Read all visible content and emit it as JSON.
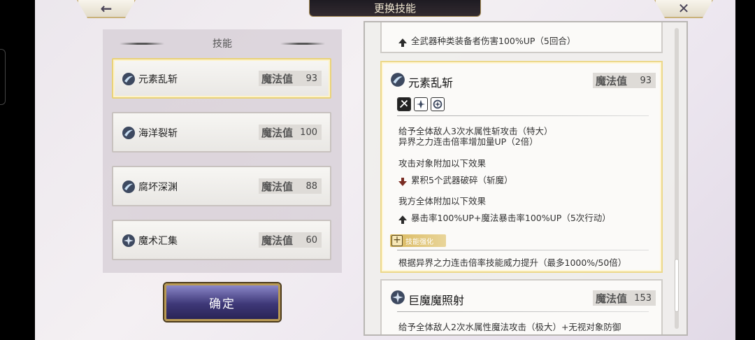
{
  "header": {
    "title": "更换技能",
    "back_icon": "←",
    "close_icon": "✕"
  },
  "left": {
    "heading": "技能",
    "skills": [
      {
        "name": "元素乱斩",
        "mp_label": "魔法值",
        "mp": "93",
        "icon": "water-slash-icon"
      },
      {
        "name": "海洋裂斩",
        "mp_label": "魔法值",
        "mp": "100",
        "icon": "water-slash-icon"
      },
      {
        "name": "腐坏深渊",
        "mp_label": "魔法值",
        "mp": "88",
        "icon": "water-slash-icon"
      },
      {
        "name": "魔术汇集",
        "mp_label": "魔法值",
        "mp": "60",
        "icon": "magic-burst-icon"
      }
    ],
    "confirm_label": "确定"
  },
  "right": {
    "prev_card_line": "全武器种类装备者伤害100%UP（5回合）",
    "detail": {
      "name": "元素乱斩",
      "mp_label": "魔法值",
      "mp": "93",
      "desc1": "给予全体敌人3次水属性斩攻击（特大）",
      "desc2": "异界之力连击倍率增加量UP（2倍）",
      "target_heading": "攻击对象附加以下效果",
      "target_effect": "累积5个武器破碎（斩魔）",
      "ally_heading": "我方全体附加以下效果",
      "ally_effect": "暴击率100%UP+魔法暴击率100%UP（5次行动）",
      "enhance_badge": "技能强化",
      "enhance_text": "根据异界之力连击倍率技能威力提升（最多1000%/50倍）"
    },
    "next_card": {
      "name": "巨魔魔照射",
      "mp_label": "魔法值",
      "mp": "153",
      "desc": "给予全体敌人2次水属性魔法攻击（极大）+无视对象防御"
    }
  }
}
